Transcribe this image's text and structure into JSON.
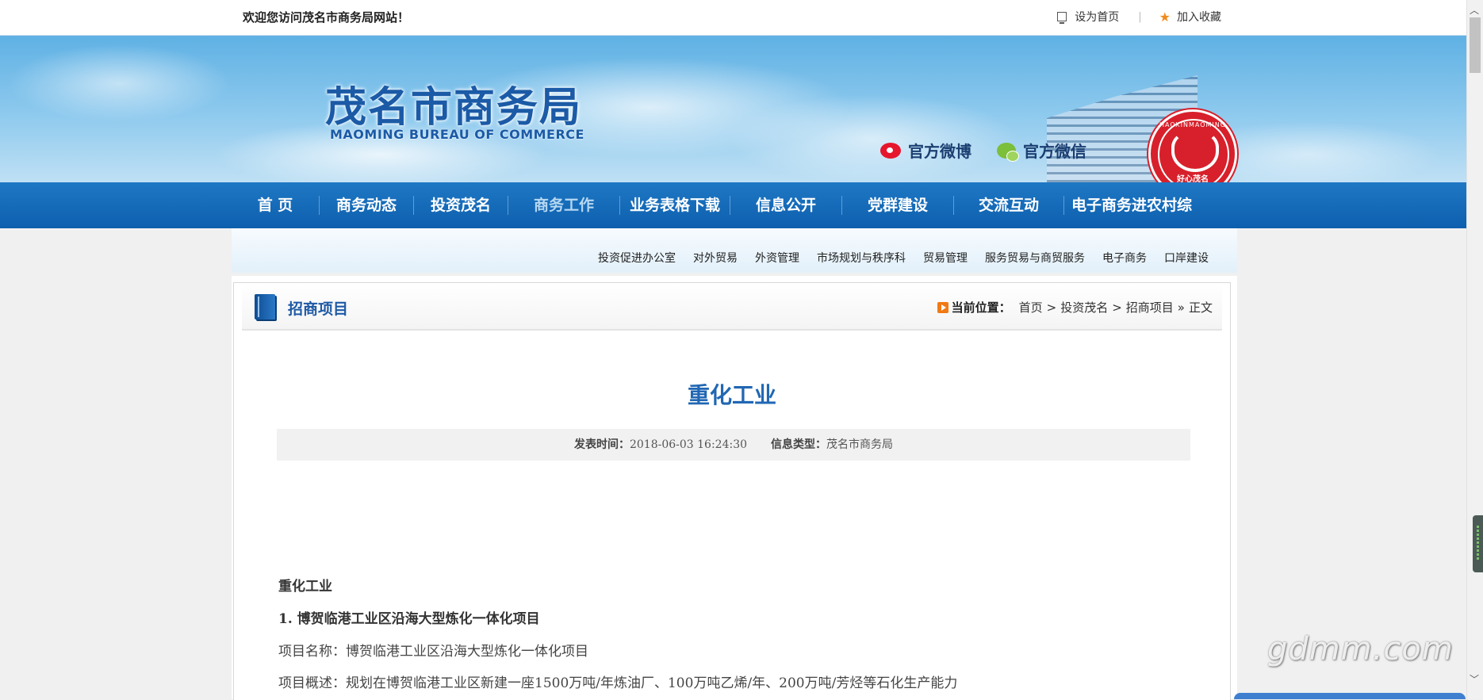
{
  "topbar": {
    "welcome": "欢迎您访问茂名市商务局网站！",
    "set_home": "设为首页",
    "separator": "|",
    "favorite": "加入收藏"
  },
  "banner": {
    "title": "茂名市商务局",
    "subtitle": "MAOMING BUREAU OF COMMERCE",
    "weibo": "官方微博",
    "wechat": "官方微信",
    "logo_top_text": "HAOXINMAOMING",
    "logo_bottom_text": "好心茂名"
  },
  "nav": {
    "items": [
      {
        "label": "首 页"
      },
      {
        "label": "商务动态"
      },
      {
        "label": "投资茂名"
      },
      {
        "label": "商务工作"
      },
      {
        "label": "业务表格下载"
      },
      {
        "label": "信息公开"
      },
      {
        "label": "党群建设"
      },
      {
        "label": "交流互动"
      },
      {
        "label": "电子商务进农村综"
      }
    ],
    "active_index": 3
  },
  "subnav": {
    "items": [
      "投资促进办公室",
      "对外贸易",
      "外资管理",
      "市场规划与秩序科",
      "贸易管理",
      "服务贸易与商贸服务",
      "电子商务",
      "口岸建设"
    ]
  },
  "section": {
    "title": "招商项目",
    "crumb_label": "当前位置：",
    "crumbs": [
      "首页",
      ">",
      "投资茂名",
      ">",
      "招商项目",
      "»",
      "正文"
    ]
  },
  "article": {
    "title": "重化工业",
    "publish_label": "发表时间：",
    "publish_time": "2018-06-03 16:24:30",
    "type_label": "信息类型：",
    "type_value": "茂名市商务局",
    "paragraphs": [
      "重化工业",
      "1. 博贺临港工业区沿海大型炼化一体化项目",
      "项目名称：博贺临港工业区沿海大型炼化一体化项目",
      "项目概述：规划在博贺临港工业区新建一座1500万吨/年炼油厂、100万吨乙烯/年、200万吨/芳烃等石化生产能力"
    ]
  },
  "watermark": "gdmm.com",
  "colors": {
    "nav_blue": "#0d5fae",
    "title_blue": "#2167b3",
    "accent_orange": "#f07a15",
    "seal_red": "#d7202b"
  }
}
